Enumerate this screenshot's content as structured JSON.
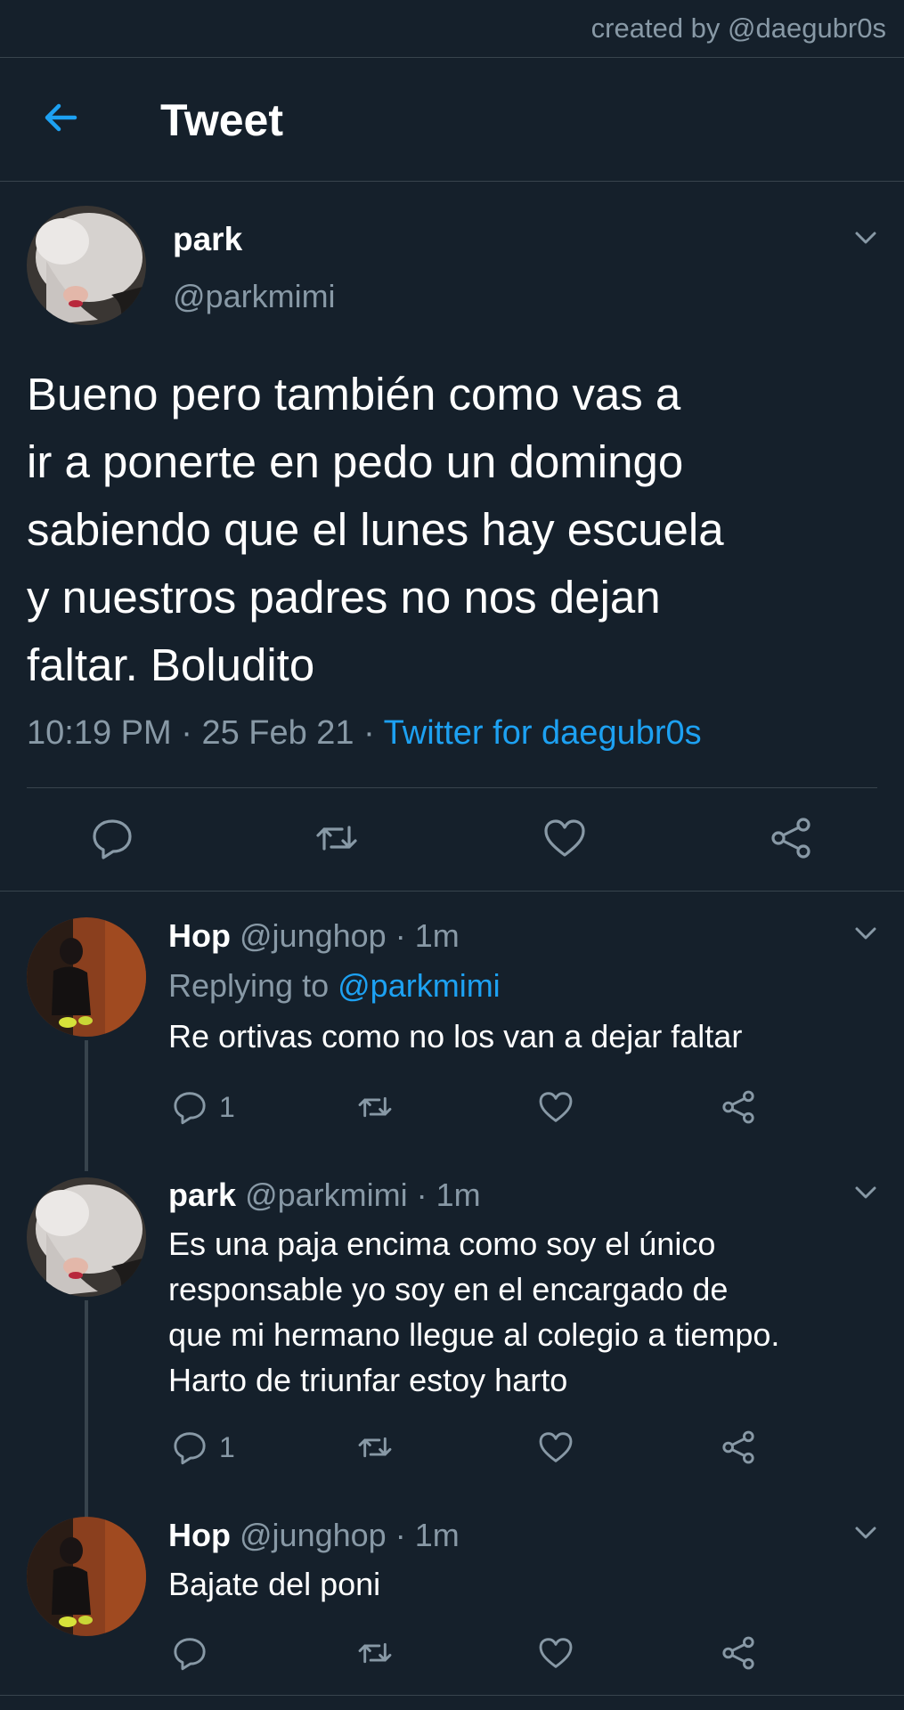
{
  "watermark": "created by @daegubr0s",
  "header": {
    "title": "Tweet",
    "back_icon": "arrow-left-icon"
  },
  "colors": {
    "background": "#15202b",
    "accent": "#1da1f2",
    "muted": "#8899a6",
    "divider": "#38444d"
  },
  "main_tweet": {
    "name": "park",
    "handle": "@parkmimi",
    "text": "Bueno pero también como vas a\nir a ponerte en pedo un domingo\nsabiendo que el lunes hay escuela\ny nuestros padres no nos dejan\nfaltar. Boludito",
    "time": "10:19 PM",
    "date": "25 Feb 21",
    "separator": "·",
    "source": "Twitter for daegubr0s"
  },
  "replies": [
    {
      "name": "Hop",
      "handle": "@junghop",
      "separator": "·",
      "age": "1m",
      "replying_prefix": "Replying to",
      "replying_to": "@parkmimi",
      "text": "Re ortivas como no los van a dejar faltar",
      "reply_count": "1"
    },
    {
      "name": "park",
      "handle": "@parkmimi",
      "separator": "·",
      "age": "1m",
      "text": "Es una paja encima como soy el único\nresponsable yo soy en el encargado de\nque mi hermano llegue al colegio a tiempo.\nHarto de triunfar estoy harto",
      "reply_count": "1"
    },
    {
      "name": "Hop",
      "handle": "@junghop",
      "separator": "·",
      "age": "1m",
      "text": "Bajate del poni",
      "reply_count": ""
    }
  ]
}
